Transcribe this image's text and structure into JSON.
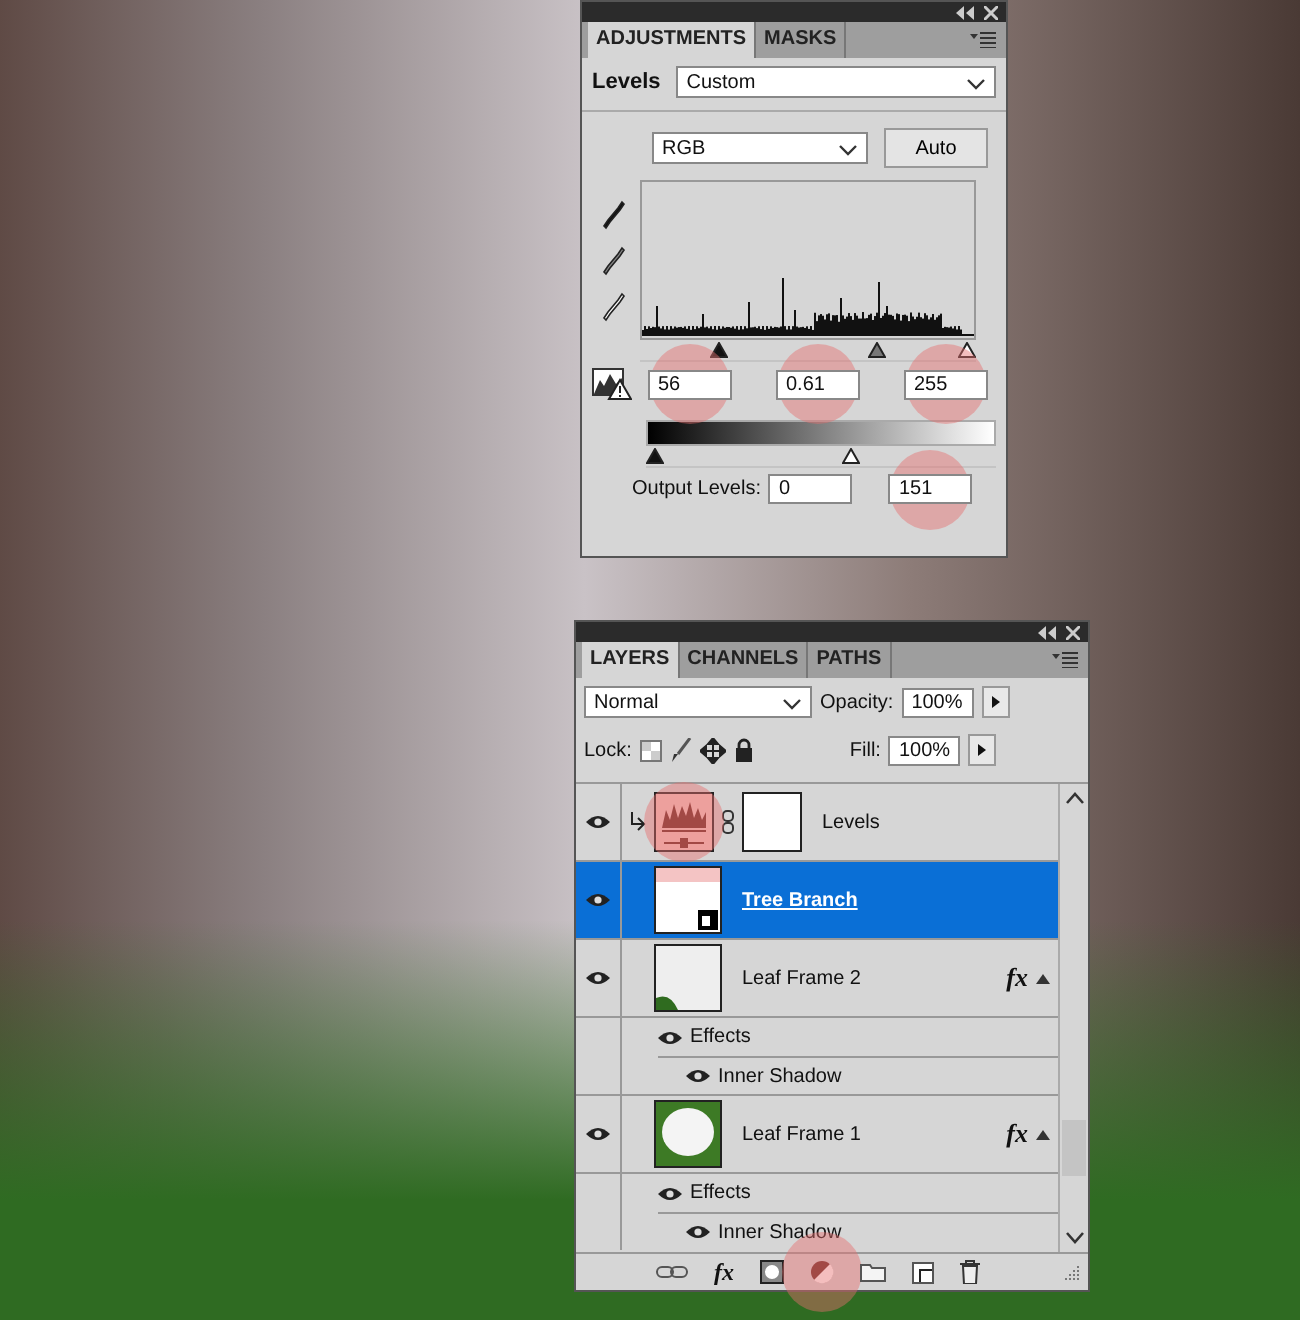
{
  "adjustments_panel": {
    "tabs": [
      {
        "label": "ADJUSTMENTS",
        "selected": true
      },
      {
        "label": "MASKS",
        "selected": false
      }
    ],
    "preset_label": "Levels",
    "preset": "Custom",
    "channel": "RGB",
    "auto_button": "Auto",
    "input_levels": [
      {
        "value": "56",
        "highlighted": true
      },
      {
        "value": "0.61",
        "highlighted": true
      },
      {
        "value": "255",
        "highlighted": true
      }
    ],
    "input_sliders": [
      {
        "kind": "black",
        "level": 0.22
      },
      {
        "kind": "gray",
        "level": 0.72
      },
      {
        "kind": "white",
        "level": 1
      }
    ],
    "output_sliders": [
      {
        "kind": "black",
        "level": 0
      },
      {
        "kind": "white",
        "level": 0.59
      }
    ],
    "output_label": "Output Levels:",
    "output_levels": [
      {
        "value": "0",
        "highlighted": false
      },
      {
        "value": "151",
        "highlighted": true
      }
    ]
  },
  "layers_panel": {
    "tabs": [
      {
        "label": "LAYERS",
        "selected": true
      },
      {
        "label": "CHANNELS",
        "selected": false
      },
      {
        "label": "PATHS",
        "selected": false
      }
    ],
    "blend_mode": "Normal",
    "opacity_label": "Opacity:",
    "opacity": "100%",
    "lock_label": "Lock:",
    "fill_label": "Fill:",
    "fill": "100%",
    "layers": [
      {
        "kind": "adjustment",
        "name": "Levels",
        "visible": true,
        "selected": false,
        "clipped": true,
        "highlighted": true
      },
      {
        "kind": "smart",
        "name": "Tree Branch",
        "visible": true,
        "selected": true,
        "clipped": false,
        "highlighted": false
      },
      {
        "kind": "frame",
        "name": "Leaf Frame 2",
        "visible": true,
        "selected": false,
        "clipped": false,
        "highlighted": false,
        "fx": "fx",
        "effects_label": "Effects",
        "effects": [
          {
            "name": "Inner Shadow",
            "visible": true
          }
        ]
      },
      {
        "kind": "frame-full",
        "name": "Leaf Frame 1",
        "visible": true,
        "selected": false,
        "clipped": false,
        "highlighted": false,
        "fx": "fx",
        "effects_label": "Effects",
        "effects": [
          {
            "name": "Inner Shadow",
            "visible": true
          }
        ]
      }
    ],
    "footer_buttons": [
      {
        "kind": "link",
        "highlighted": false
      },
      {
        "kind": "fx",
        "label": "fx",
        "highlighted": false
      },
      {
        "kind": "mask",
        "highlighted": false
      },
      {
        "kind": "adjustment",
        "highlighted": true
      },
      {
        "kind": "group",
        "highlighted": false
      },
      {
        "kind": "new",
        "highlighted": false
      },
      {
        "kind": "trash",
        "highlighted": false
      }
    ]
  }
}
